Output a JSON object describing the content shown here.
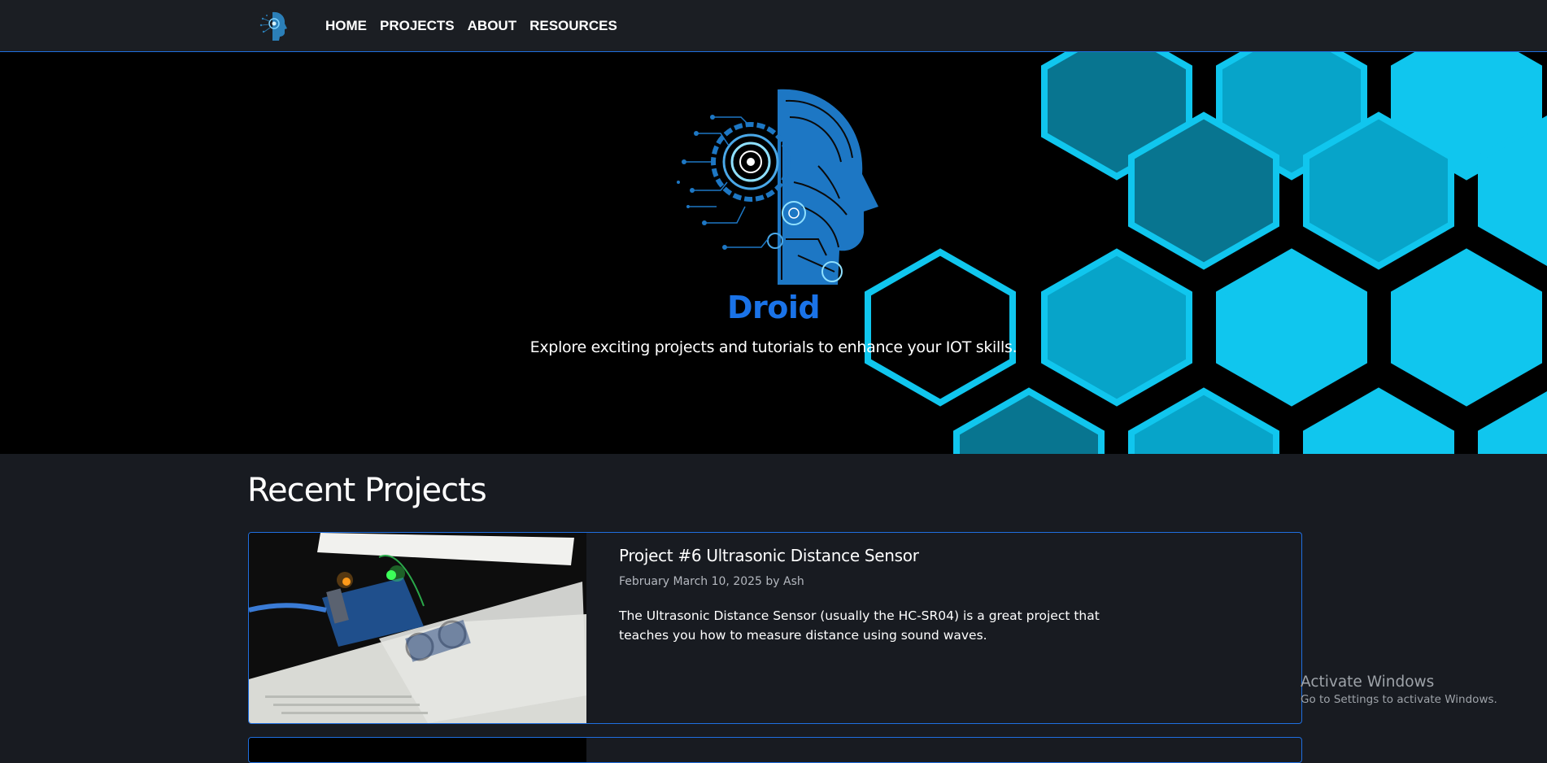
{
  "nav": {
    "logo_icon": "droid-head-icon",
    "links": [
      "HOME",
      "PROJECTS",
      "ABOUT",
      "RESOURCES"
    ]
  },
  "hero": {
    "art_icon": "circuit-robot-head",
    "title": "Droid",
    "subtitle": "Explore exciting projects and tutorials to enhance your IOT skills.",
    "colors": {
      "title": "#1a73e8",
      "hex_light": "#10c6ee",
      "hex_mid": "#07a4c9",
      "hex_dark": "#087590"
    }
  },
  "projects": {
    "heading": "Recent Projects",
    "items": [
      {
        "title": "Project #6 Ultrasonic Distance Sensor",
        "meta": "February March 10, 2025 by Ash",
        "description": "The Ultrasonic Distance Sensor (usually the HC-SR04) is a great project that teaches you how to measure distance using sound waves.",
        "image_icon": "arduino-ultrasonic-photo"
      }
    ]
  },
  "watermark": {
    "title": "Activate Windows",
    "subtitle": "Go to Settings to activate Windows."
  },
  "theme": {
    "accent": "#1f6fe0",
    "background": "#181b21",
    "navbar": "#1b1e23"
  }
}
